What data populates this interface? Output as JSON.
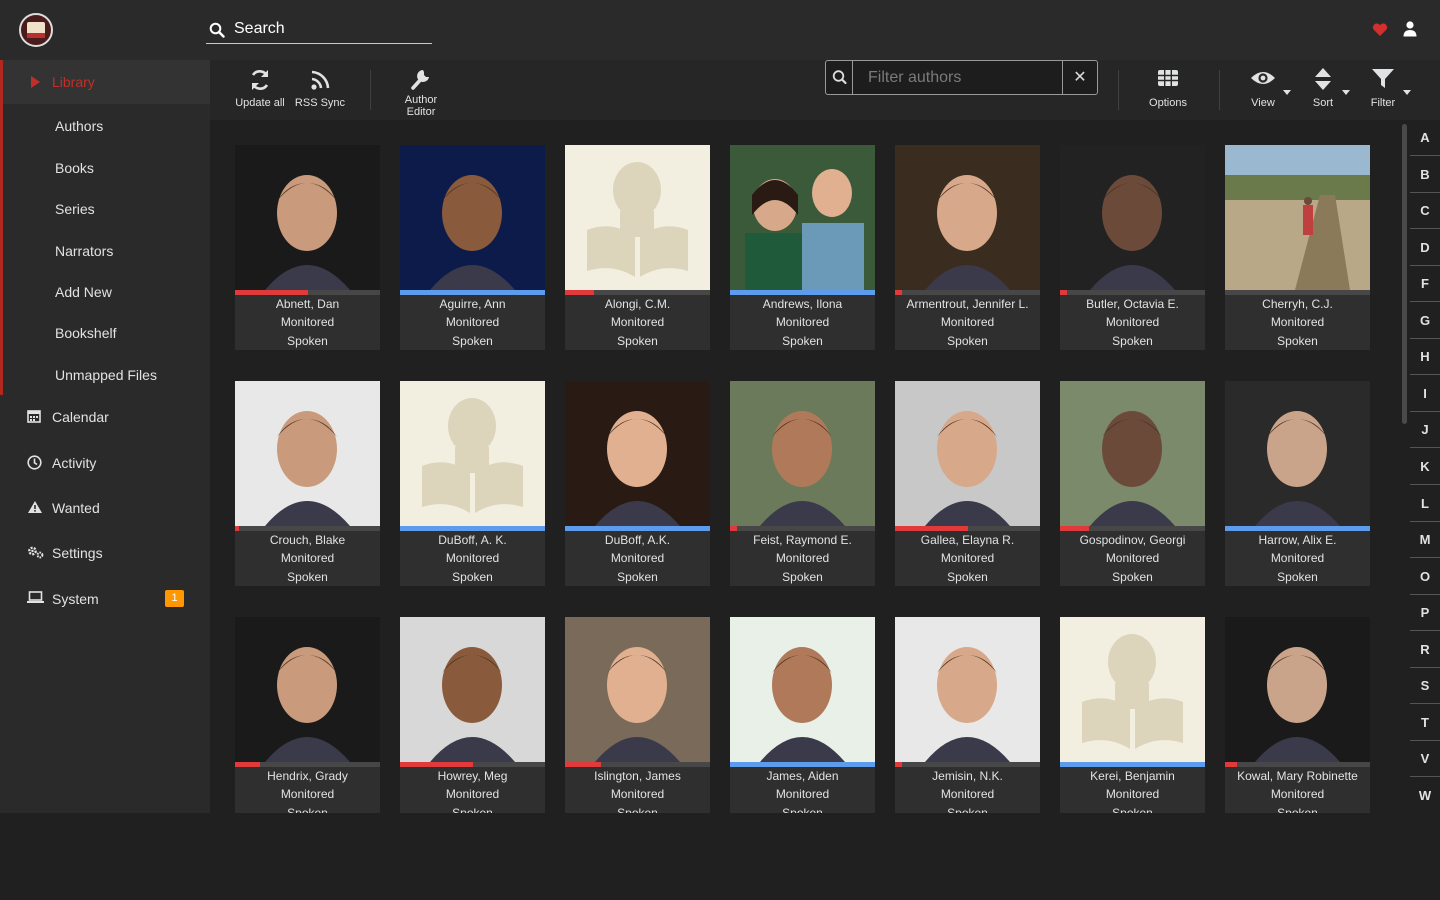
{
  "header": {
    "search_placeholder": "Search",
    "accent": "#c03028"
  },
  "sidebar": {
    "library_label": "Library",
    "sub_items": [
      "Authors",
      "Books",
      "Series",
      "Narrators",
      "Add New",
      "Bookshelf",
      "Unmapped Files"
    ],
    "items": [
      {
        "label": "Calendar",
        "icon": "calendar-icon"
      },
      {
        "label": "Activity",
        "icon": "clock-icon"
      },
      {
        "label": "Wanted",
        "icon": "warning-icon"
      },
      {
        "label": "Settings",
        "icon": "gears-icon"
      },
      {
        "label": "System",
        "icon": "laptop-icon",
        "badge": "1"
      }
    ]
  },
  "toolbar": {
    "update_all": "Update all",
    "rss_sync": "RSS Sync",
    "author_editor_1": "Author",
    "author_editor_2": "Editor",
    "filter_placeholder": "Filter authors",
    "options": "Options",
    "view": "View",
    "sort": "Sort",
    "filter": "Filter"
  },
  "authors": [
    {
      "name": "Abnett, Dan",
      "status": "Monitored",
      "profile": "Spoken",
      "progress": 0.5,
      "color": "#e03a3a",
      "photo": "person"
    },
    {
      "name": "Aguirre, Ann",
      "status": "Monitored",
      "profile": "Spoken",
      "progress": 1.0,
      "color": "#5d9cec",
      "photo": "person"
    },
    {
      "name": "Alongi, C.M.",
      "status": "Monitored",
      "profile": "Spoken",
      "progress": 0.2,
      "color": "#e03a3a",
      "photo": "placeholder"
    },
    {
      "name": "Andrews, Ilona",
      "status": "Monitored",
      "profile": "Spoken",
      "progress": 1.0,
      "color": "#5d9cec",
      "photo": "couple"
    },
    {
      "name": "Armentrout, Jennifer L.",
      "status": "Monitored",
      "profile": "Spoken",
      "progress": 0.05,
      "color": "#e03a3a",
      "photo": "person"
    },
    {
      "name": "Butler, Octavia E.",
      "status": "Monitored",
      "profile": "Spoken",
      "progress": 0.05,
      "color": "#e03a3a",
      "photo": "person"
    },
    {
      "name": "Cherryh, C.J.",
      "status": "Monitored",
      "profile": "Spoken",
      "progress": 0.0,
      "color": "#e03a3a",
      "photo": "landscape"
    },
    {
      "name": "Crouch, Blake",
      "status": "Monitored",
      "profile": "Spoken",
      "progress": 0.03,
      "color": "#e03a3a",
      "photo": "person"
    },
    {
      "name": "DuBoff, A. K.",
      "status": "Monitored",
      "profile": "Spoken",
      "progress": 1.0,
      "color": "#5d9cec",
      "photo": "placeholder"
    },
    {
      "name": "DuBoff, A.K.",
      "status": "Monitored",
      "profile": "Spoken",
      "progress": 1.0,
      "color": "#5d9cec",
      "photo": "person"
    },
    {
      "name": "Feist, Raymond E.",
      "status": "Monitored",
      "profile": "Spoken",
      "progress": 0.05,
      "color": "#e03a3a",
      "photo": "person"
    },
    {
      "name": "Gallea, Elayna R.",
      "status": "Monitored",
      "profile": "Spoken",
      "progress": 0.5,
      "color": "#e03a3a",
      "photo": "person"
    },
    {
      "name": "Gospodinov, Georgi",
      "status": "Monitored",
      "profile": "Spoken",
      "progress": 0.2,
      "color": "#e03a3a",
      "photo": "person"
    },
    {
      "name": "Harrow, Alix E.",
      "status": "Monitored",
      "profile": "Spoken",
      "progress": 1.0,
      "color": "#5d9cec",
      "photo": "person"
    },
    {
      "name": "Hendrix, Grady",
      "status": "Monitored",
      "profile": "Spoken",
      "progress": 0.17,
      "color": "#e03a3a",
      "photo": "person"
    },
    {
      "name": "Howrey, Meg",
      "status": "Monitored",
      "profile": "Spoken",
      "progress": 0.5,
      "color": "#e03a3a",
      "photo": "person"
    },
    {
      "name": "Islington, James",
      "status": "Monitored",
      "profile": "Spoken",
      "progress": 0.25,
      "color": "#e03a3a",
      "photo": "person"
    },
    {
      "name": "James, Aiden",
      "status": "Monitored",
      "profile": "Spoken",
      "progress": 1.0,
      "color": "#5d9cec",
      "photo": "person"
    },
    {
      "name": "Jemisin, N.K.",
      "status": "Monitored",
      "profile": "Spoken",
      "progress": 0.05,
      "color": "#e03a3a",
      "photo": "person"
    },
    {
      "name": "Kerei, Benjamin",
      "status": "Monitored",
      "profile": "Spoken",
      "progress": 1.0,
      "color": "#5d9cec",
      "photo": "placeholder"
    },
    {
      "name": "Kowal, Mary Robinette",
      "status": "Monitored",
      "profile": "Spoken",
      "progress": 0.08,
      "color": "#e03a3a",
      "photo": "person"
    }
  ],
  "jump_letters": [
    "A",
    "B",
    "C",
    "D",
    "F",
    "G",
    "H",
    "I",
    "J",
    "K",
    "L",
    "M",
    "O",
    "P",
    "R",
    "S",
    "T",
    "V",
    "W"
  ]
}
